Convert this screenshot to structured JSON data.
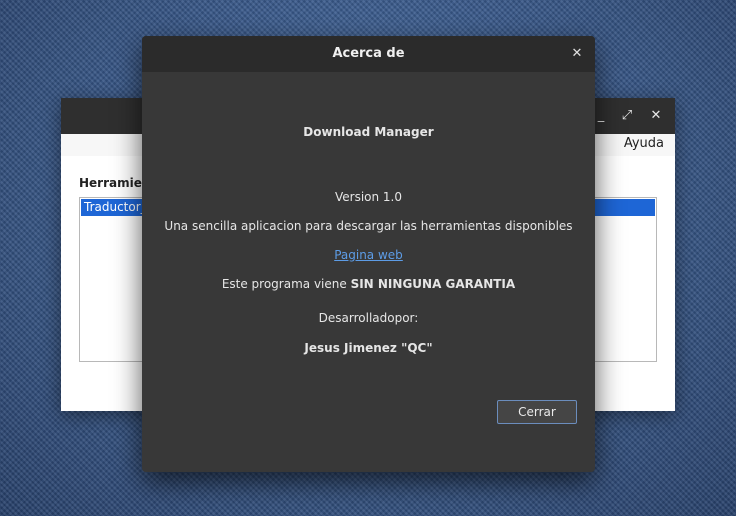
{
  "main_window": {
    "menu": {
      "help_label": "Ayuda"
    },
    "tools_label": "Herramien",
    "list_items": [
      "Traductor_"
    ],
    "controls": {
      "minimize": "_",
      "maximize": "⤢",
      "close": "✕"
    }
  },
  "about_dialog": {
    "title": "Acerca de",
    "close_icon": "✕",
    "program_name": "Download Manager",
    "version": "Version 1.0",
    "comments": "Una sencilla aplicacion para descargar las herramientas disponibles",
    "website_label": "Pagina web",
    "license_prefix": "Este programa viene ",
    "license_emphasis": "SIN NINGUNA GARANTIA",
    "credits_label": "Desarrolladopor:",
    "author": "Jesus Jimenez \"QC\"",
    "close_button": "Cerrar"
  },
  "colors": {
    "dialog_bg": "#383838",
    "titlebar_bg": "#2b2b2b",
    "link": "#5d9ce6",
    "selection": "#1e66d6",
    "button_border": "#6b8dbd"
  }
}
